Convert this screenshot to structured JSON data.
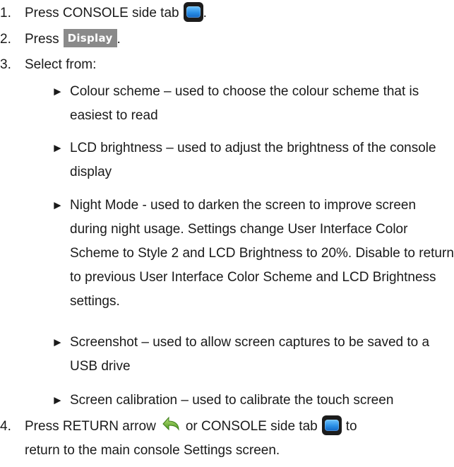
{
  "steps": [
    {
      "num": "1.",
      "text_before": "Press CONSOLE side tab",
      "text_after": "."
    },
    {
      "num": "2.",
      "text_before": "Press",
      "button_label": "Display",
      "text_after": "."
    },
    {
      "num": "3.",
      "text": "Select from:"
    },
    {
      "num": "4.",
      "text_before": "Press RETURN arrow",
      "text_middle": "or CONSOLE side tab",
      "text_after": "to",
      "line2": "return to the main console Settings screen."
    }
  ],
  "bullet_glyph": "►",
  "options": [
    {
      "label": "Colour scheme – used to choose the colour scheme that is easiest to read"
    },
    {
      "label": "LCD brightness – used to adjust the brightness of the console display"
    },
    {
      "label": "Night Mode - used to darken the screen to improve screen during night usage. Settings change User Interface Color Scheme to Style 2 and LCD Brightness to 20%. Disable to return to previous User Interface Color Scheme and LCD Brightness settings."
    },
    {
      "label": "Screenshot – used to allow screen captures to be saved to a USB drive"
    },
    {
      "label": "Screen calibration – used to calibrate the touch screen"
    }
  ],
  "icons": {
    "console_tab": "console-tab-icon",
    "return_arrow": "return-arrow-icon"
  },
  "colors": {
    "display_button_bg": "#8a8a8a",
    "console_tab_blue": "#2a8fe6",
    "return_arrow_green": "#6aa832"
  }
}
